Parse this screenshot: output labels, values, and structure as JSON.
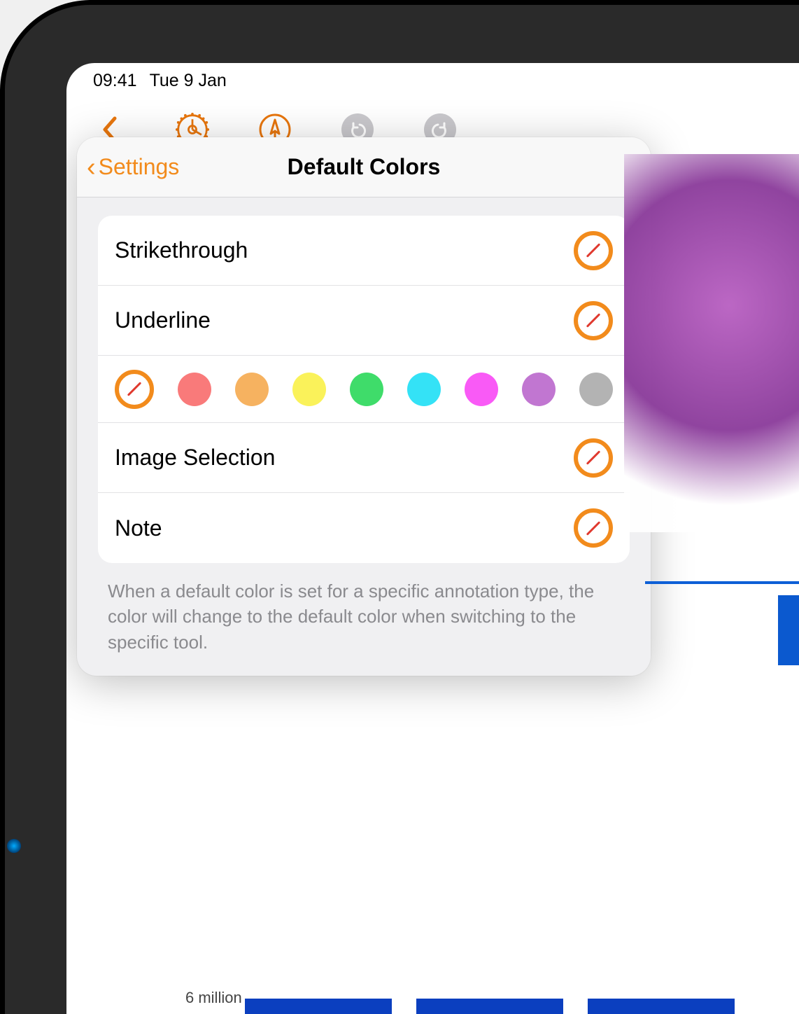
{
  "status": {
    "time": "09:41",
    "date": "Tue 9 Jan"
  },
  "toolbar": {
    "accent": "#e8760d"
  },
  "popover": {
    "back_label": "Settings",
    "title": "Default Colors",
    "rows": {
      "strikethrough": "Strikethrough",
      "underline": "Underline",
      "image_selection": "Image Selection",
      "note": "Note"
    },
    "palette": [
      {
        "name": "none",
        "selected": true,
        "color": "#ffffff"
      },
      {
        "name": "coral",
        "color": "#f97a7a"
      },
      {
        "name": "orange",
        "color": "#f6b260"
      },
      {
        "name": "yellow",
        "color": "#faf25a"
      },
      {
        "name": "green",
        "color": "#3fdc6a"
      },
      {
        "name": "cyan",
        "color": "#34e2f6"
      },
      {
        "name": "magenta",
        "color": "#f95af6"
      },
      {
        "name": "purple",
        "color": "#c176d1"
      },
      {
        "name": "grey",
        "color": "#b3b3b3"
      }
    ],
    "footer": "When a default color is set for a specific annotation type, the color will change to the default color when switching to the specific tool."
  },
  "background": {
    "chart_label": "6 million"
  }
}
